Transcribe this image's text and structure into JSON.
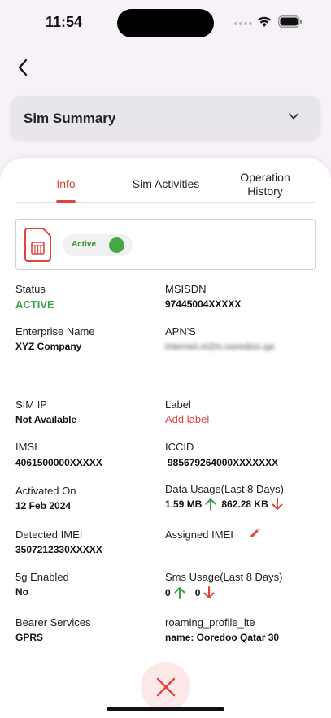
{
  "status_bar": {
    "time": "11:54"
  },
  "header": {
    "summary_title": "Sim Summary"
  },
  "tabs": [
    {
      "label": "Info"
    },
    {
      "label": "Sim Activities"
    },
    {
      "label": "Operation History"
    }
  ],
  "sim_card": {
    "toggle_label": "Active"
  },
  "fields": {
    "status": {
      "label": "Status",
      "value": "ACTIVE"
    },
    "msisdn": {
      "label": "MSISDN",
      "value": "97445004XXXXX"
    },
    "enterprise": {
      "label": "Enterprise Name",
      "value": "XYZ Company"
    },
    "apn": {
      "label": "APN'S",
      "value": "internet.m2m.ooredoo.qa"
    },
    "sim_ip": {
      "label": "SIM IP",
      "value": "Not Available"
    },
    "label": {
      "label": "Label",
      "value": "Add label"
    },
    "imsi": {
      "label": "IMSI",
      "value": "4061500000XXXXX"
    },
    "iccid": {
      "label": "ICCID",
      "value": "985679264000XXXXXXX"
    },
    "activated_on": {
      "label": "Activated On",
      "value": "12 Feb 2024"
    },
    "data_usage": {
      "label": "Data Usage(Last 8 Days)",
      "up": "1.59 MB",
      "down": "862.28 KB"
    },
    "detected_imei": {
      "label": "Detected IMEI",
      "value": "3507212330XXXXX"
    },
    "assigned_imei": {
      "label": "Assigned IMEI"
    },
    "fiveg": {
      "label": "5g Enabled",
      "value": "No"
    },
    "sms_usage": {
      "label": "Sms Usage(Last 8 Days)",
      "up": "0",
      "down": "0"
    },
    "bearer": {
      "label": "Bearer Services",
      "value": "GPRS"
    },
    "roaming": {
      "label": "roaming_profile_lte",
      "value": "name: Ooredoo Qatar 30"
    }
  },
  "colors": {
    "accent": "#e0443d",
    "active": "#3aa14c",
    "up_arrow": "#3aa14c",
    "down_arrow": "#e0443d"
  },
  "icons": [
    "back-arrow-icon",
    "chevron-down-icon",
    "sim-card-icon",
    "arrow-up-icon",
    "arrow-down-icon",
    "pencil-icon",
    "close-icon"
  ]
}
